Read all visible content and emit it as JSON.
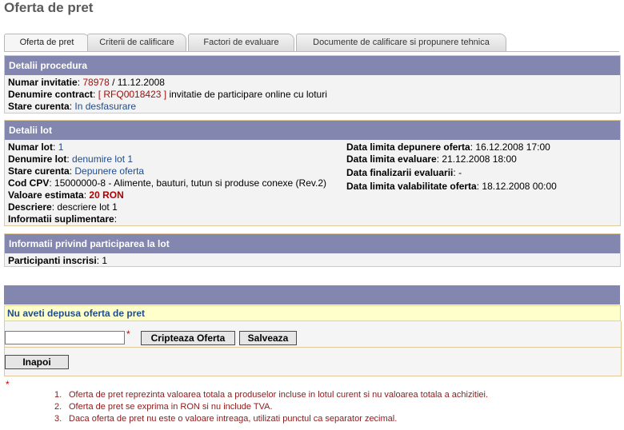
{
  "page": {
    "title": "Oferta de pret"
  },
  "tabs": [
    {
      "label": "Oferta de pret"
    },
    {
      "label": "Criterii de calificare"
    },
    {
      "label": "Factori de evaluare"
    },
    {
      "label": "Documente de calificare si propunere tehnica"
    }
  ],
  "procedura": {
    "header": "Detalii procedura",
    "invitatie_label": "Numar invitatie",
    "invitatie_nr": "78978",
    "invitatie_date": "11.12.2008",
    "contract_label": "Denumire contract",
    "contract_code": "[ RFQ0018423 ]",
    "contract_name": "invitatie de participare online cu loturi",
    "stare_label": "Stare curenta",
    "stare_value": "In desfasurare"
  },
  "lot": {
    "header": "Detalii lot",
    "numar_label": "Numar lot",
    "numar_value": "1",
    "denumire_label": "Denumire lot",
    "denumire_value": "denumire lot 1",
    "stare_label": "Stare curenta",
    "stare_value": "Depunere oferta",
    "cpv_label": "Cod CPV",
    "cpv_value": "15000000-8 - Alimente, bauturi, tutun si produse conexe (Rev.2)",
    "valoare_label": "Valoare estimata",
    "valoare_value": "20 RON",
    "descriere_label": "Descriere",
    "descriere_value": "descriere lot 1",
    "info_label": "Informatii suplimentare",
    "depunere_label": "Data limita depunere oferta",
    "depunere_value": "16.12.2008 17:00",
    "evaluare_label": "Data limita evaluare",
    "evaluare_value": "21.12.2008 18:00",
    "finalizare_label": "Data finalizarii evaluarii",
    "finalizare_value": "-",
    "valabilitate_label": "Data limita valabilitate oferta",
    "valabilitate_value": "18.12.2008 00:00"
  },
  "participare": {
    "header": "Informatii privind participarea la lot",
    "participanti_label": "Participanti inscrisi",
    "participanti_value": "1"
  },
  "oferta": {
    "notice": "Nu aveti depusa oferta de pret",
    "input_value": "",
    "required_mark": "*",
    "encrypt_label": "Cripteaza Oferta",
    "save_label": "Salveaza",
    "back_label": "Inapoi"
  },
  "footnotes": {
    "star": "*",
    "items": [
      "Oferta de pret reprezinta valoarea totala a produselor incluse in lotul curent si nu valoarea totala a achizitiei.",
      "Oferta de pret se exprima in RON si nu include TVA.",
      "Daca oferta de pret nu este o valoare intreaga, utilizati punctul ca separator zecimal."
    ],
    "numbers": [
      "1.",
      "2.",
      "3."
    ]
  }
}
